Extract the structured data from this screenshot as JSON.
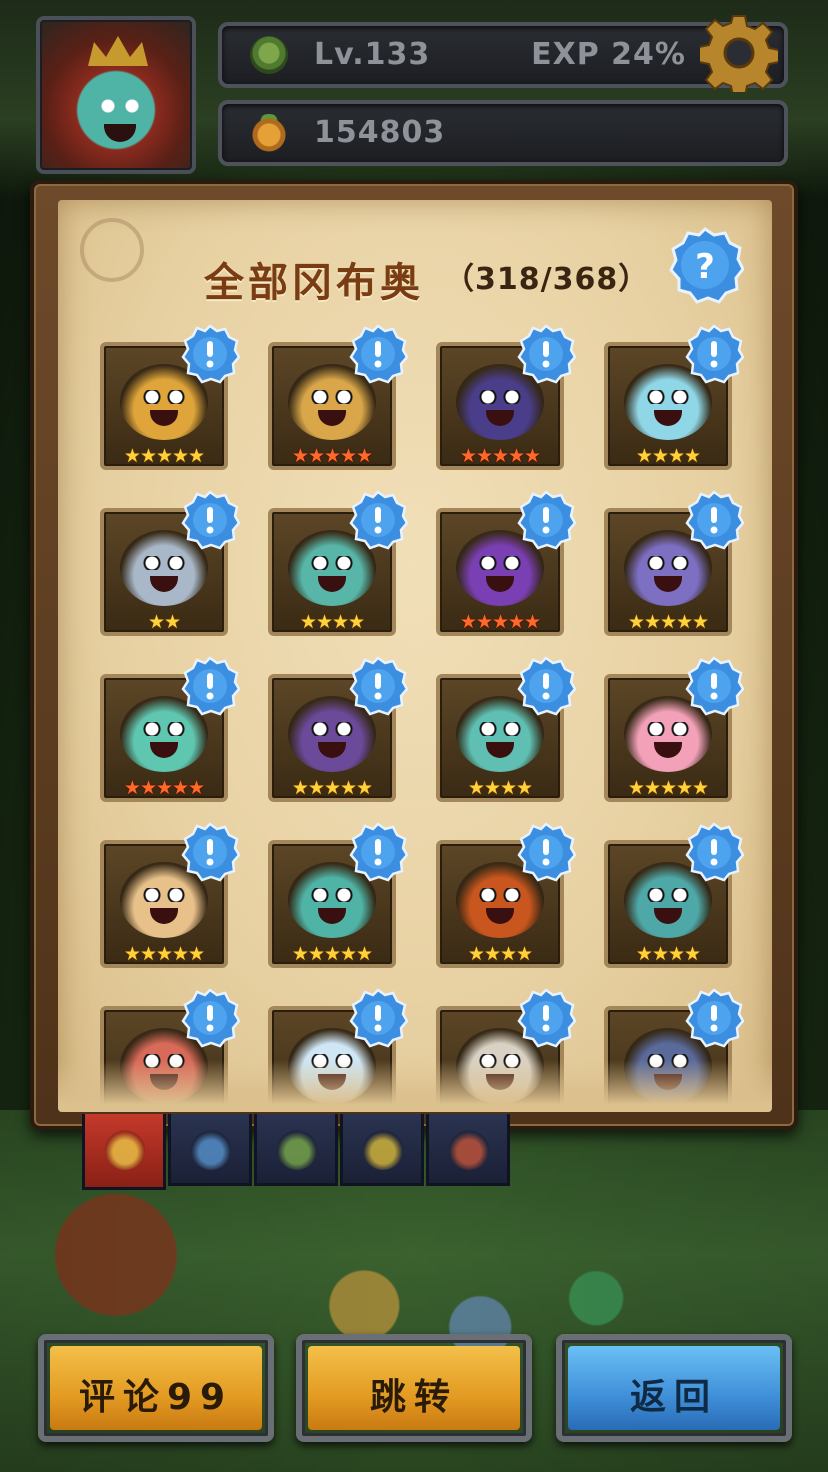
{
  "header": {
    "level_label": "Lv.133",
    "exp_label": "EXP 24%",
    "coins": "154803",
    "icons": {
      "avatar": "player-avatar",
      "level": "tree-icon",
      "coins": "fruit-coin-icon",
      "settings": "gear-icon"
    }
  },
  "panel": {
    "title": "全部冈布奥",
    "count": "（318/368）",
    "help_icon": "question-icon"
  },
  "cards": [
    {
      "stars": "★★★★★",
      "star_color": "gold"
    },
    {
      "stars": "★★★★★",
      "star_color": "red"
    },
    {
      "stars": "★★★★★",
      "star_color": "red"
    },
    {
      "stars": "★★★★",
      "star_color": "gold"
    },
    {
      "stars": "★★",
      "star_color": "gold"
    },
    {
      "stars": "★★★★",
      "star_color": "gold"
    },
    {
      "stars": "★★★★★",
      "star_color": "red"
    },
    {
      "stars": "★★★★★",
      "star_color": "gold"
    },
    {
      "stars": "★★★★★",
      "star_color": "red"
    },
    {
      "stars": "★★★★★",
      "star_color": "gold"
    },
    {
      "stars": "★★★★",
      "star_color": "gold"
    },
    {
      "stars": "★★★★★",
      "star_color": "gold"
    },
    {
      "stars": "★★★★★",
      "star_color": "gold"
    },
    {
      "stars": "★★★★★",
      "star_color": "gold"
    },
    {
      "stars": "★★★★",
      "star_color": "gold"
    },
    {
      "stars": "★★★★",
      "star_color": "gold"
    },
    {
      "stars": "",
      "star_color": "gold"
    },
    {
      "stars": "",
      "star_color": "gold"
    },
    {
      "stars": "",
      "star_color": "gold"
    },
    {
      "stars": "",
      "star_color": "gold"
    }
  ],
  "card_alert_icon": "exclamation-icon",
  "tabs": [
    {
      "name": "all-tab",
      "active": true
    },
    {
      "name": "blue-tab",
      "active": false
    },
    {
      "name": "green-tab",
      "active": false
    },
    {
      "name": "yellow-tab",
      "active": false
    },
    {
      "name": "red-tab",
      "active": false
    }
  ],
  "buttons": {
    "comment": "评论99",
    "jump": "跳转",
    "back": "返回"
  },
  "colors": {
    "gold_button": "#e39b22",
    "blue_button": "#3f8fd8",
    "title": "#7a3c12",
    "alert_badge": "#3b8ee0"
  }
}
